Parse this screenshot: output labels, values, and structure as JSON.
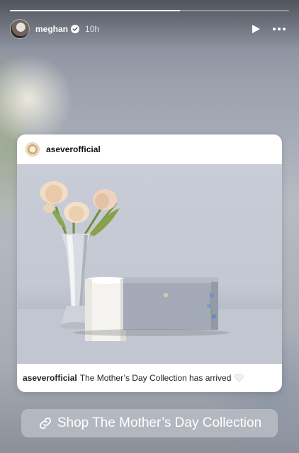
{
  "story": {
    "progress_fraction": 0.61,
    "user": {
      "username": "meghan",
      "verified": true,
      "time_ago": "10h"
    },
    "controls": {
      "play_icon": "play-icon",
      "more_icon": "more-options-icon"
    }
  },
  "post": {
    "username": "aseverofficial",
    "caption_user": "aseverofficial",
    "caption_text": "The Mother’s Day Collection has arrived",
    "caption_emoji_icon": "white-heart-icon"
  },
  "link_sticker": {
    "icon": "link-icon",
    "label": "Shop The Mother’s Day Collection"
  },
  "colors": {
    "progress_fill": "#ffffff",
    "progress_track": "rgba(255,255,255,0.35)",
    "card_bg": "#ffffff",
    "sticker_bg": "rgba(190,194,202,0.75)"
  }
}
